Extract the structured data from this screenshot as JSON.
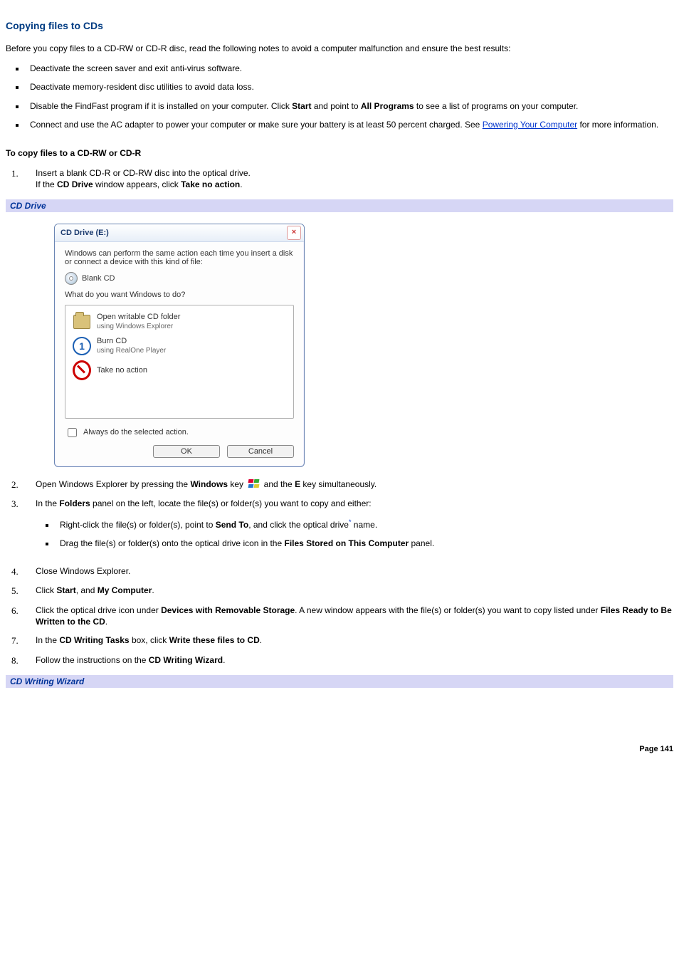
{
  "heading": "Copying files to CDs",
  "intro": "Before you copy files to a CD-RW or CD-R disc, read the following notes to avoid a computer malfunction and ensure the best results:",
  "notes": {
    "n1": "Deactivate the screen saver and exit anti-virus software.",
    "n2": "Deactivate memory-resident disc utilities to avoid data loss.",
    "n3_a": "Disable the FindFast program if it is installed on your computer. Click ",
    "n3_b": "Start",
    "n3_c": " and point to ",
    "n3_d": "All Programs",
    "n3_e": " to see a list of programs on your computer.",
    "n4_a": "Connect and use the AC adapter to power your computer or make sure your battery is at least 50 percent charged. See ",
    "n4_link": "Powering Your Computer",
    "n4_b": " for more information."
  },
  "subheading": "To copy files to a CD-RW or CD-R",
  "step1_a": "Insert a blank CD-R or CD-RW disc into the optical drive.",
  "step1_b_a": "If the ",
  "step1_b_b": "CD Drive",
  "step1_b_c": " window appears, click ",
  "step1_b_d": "Take no action",
  "step1_b_e": ".",
  "caption1": "CD Drive",
  "dialog": {
    "title": "CD Drive (E:)",
    "msg": "Windows can perform the same action each time you insert a disk or connect a device with this kind of file:",
    "disc": "Blank CD",
    "question": "What do you want Windows to do?",
    "opt1_t": "Open writable CD folder",
    "opt1_s": "using Windows Explorer",
    "opt2_t": "Burn CD",
    "opt2_s": "using RealOne Player",
    "opt3_t": "Take no action",
    "check": "Always do the selected action.",
    "ok": "OK",
    "cancel": "Cancel"
  },
  "step2_a": "Open Windows Explorer by pressing the ",
  "step2_b": "Windows",
  "step2_c": " key ",
  "step2_d": " and the ",
  "step2_e": "E",
  "step2_f": " key simultaneously.",
  "step3_a": "In the ",
  "step3_b": "Folders",
  "step3_c": " panel on the left, locate the file(s) or folder(s) you want to copy and either:",
  "step3_s1_a": "Right-click the file(s) or folder(s), point to ",
  "step3_s1_b": "Send To",
  "step3_s1_c": ", and click the optical drive",
  "step3_s1_sup": "*",
  "step3_s1_d": " name.",
  "step3_s2_a": "Drag the file(s) or folder(s) onto the optical drive icon in the ",
  "step3_s2_b": "Files Stored on This Computer",
  "step3_s2_c": " panel.",
  "step4": "Close Windows Explorer.",
  "step5_a": "Click ",
  "step5_b": "Start",
  "step5_c": ", and ",
  "step5_d": "My Computer",
  "step5_e": ".",
  "step6_a": "Click the optical drive icon under ",
  "step6_b": "Devices with Removable Storage",
  "step6_c": ". A new window appears with the file(s) or folder(s) you want to copy listed under ",
  "step6_d": "Files Ready to Be Written to the CD",
  "step6_e": ".",
  "step7_a": "In the ",
  "step7_b": "CD Writing Tasks",
  "step7_c": " box, click ",
  "step7_d": "Write these files to CD",
  "step7_e": ".",
  "step8_a": "Follow the instructions on the ",
  "step8_b": "CD Writing Wizard",
  "step8_c": ".",
  "caption2": "CD Writing Wizard",
  "pagenum": "Page 141"
}
